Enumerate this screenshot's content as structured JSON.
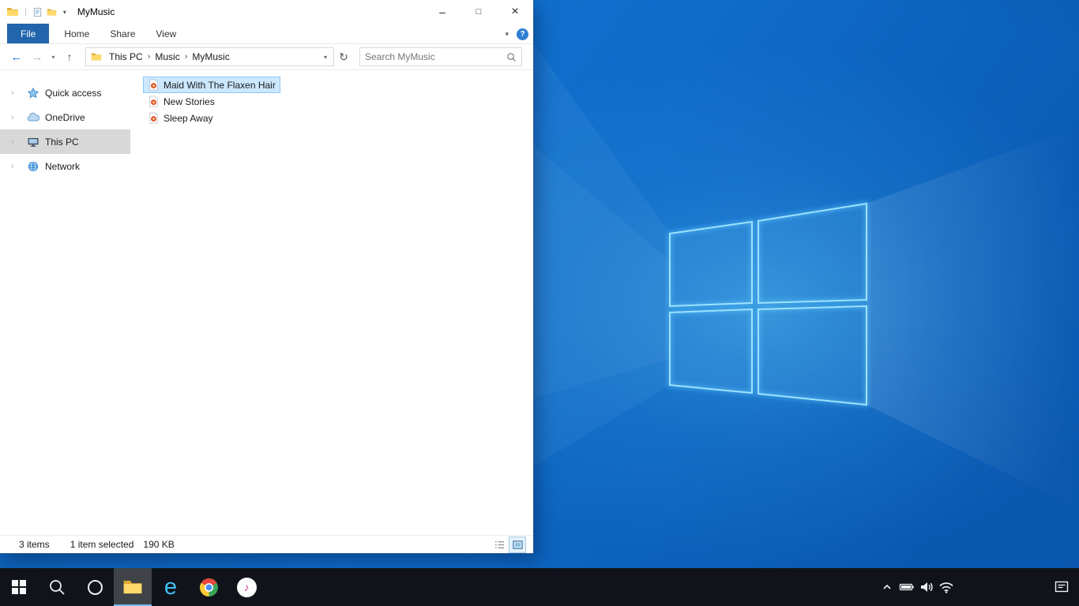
{
  "window": {
    "title": "MyMusic",
    "qat": {
      "separator": "|",
      "customize_chevron": "▾"
    },
    "controls": {
      "minimize": "–",
      "maximize": "□",
      "close": "×"
    },
    "ribbon": {
      "tabs": [
        {
          "label": "File",
          "active": true
        },
        {
          "label": "Home",
          "active": false
        },
        {
          "label": "Share",
          "active": false
        },
        {
          "label": "View",
          "active": false
        }
      ],
      "collapse_chevron": "▾",
      "help_label": "?"
    },
    "nav": {
      "back_glyph": "←",
      "forward_glyph": "→",
      "recent_chevron": "▾",
      "up_glyph": "↑",
      "breadcrumb": [
        {
          "label": "This PC"
        },
        {
          "label": "Music"
        },
        {
          "label": "MyMusic"
        }
      ],
      "crumb_separator": "›",
      "address_chevron": "▾",
      "refresh_glyph": "↻",
      "search_placeholder": "Search MyMusic"
    },
    "sidebar": {
      "expander_glyph": "›",
      "items": [
        {
          "label": "Quick access",
          "icon": "star",
          "selected": false
        },
        {
          "label": "OneDrive",
          "icon": "cloud",
          "selected": false
        },
        {
          "label": "This PC",
          "icon": "monitor",
          "selected": true
        },
        {
          "label": "Network",
          "icon": "globe",
          "selected": false
        }
      ]
    },
    "files": [
      {
        "name": "Maid With The Flaxen Hair",
        "icon": "audio-file",
        "selected": true
      },
      {
        "name": "New Stories",
        "icon": "audio-file",
        "selected": false
      },
      {
        "name": "Sleep Away",
        "icon": "audio-file",
        "selected": false
      }
    ],
    "statusbar": {
      "item_count": "3 items",
      "selection": "1 item selected",
      "selection_size": "190 KB"
    }
  },
  "taskbar": {
    "items": [
      {
        "icon": "start-windows"
      },
      {
        "icon": "search"
      },
      {
        "icon": "cortana"
      },
      {
        "icon": "file-explorer",
        "active": true
      },
      {
        "icon": "internet-explorer",
        "glyph": "e"
      },
      {
        "icon": "chrome"
      },
      {
        "icon": "itunes",
        "glyph": "♪"
      }
    ],
    "tray": {
      "hidden_icons": "chevron-up",
      "icons": [
        "battery",
        "volume",
        "wifi"
      ],
      "action_center": "action-center"
    }
  },
  "wallpaper": {
    "accent": "#8adcff",
    "base": "#0f6dca"
  }
}
